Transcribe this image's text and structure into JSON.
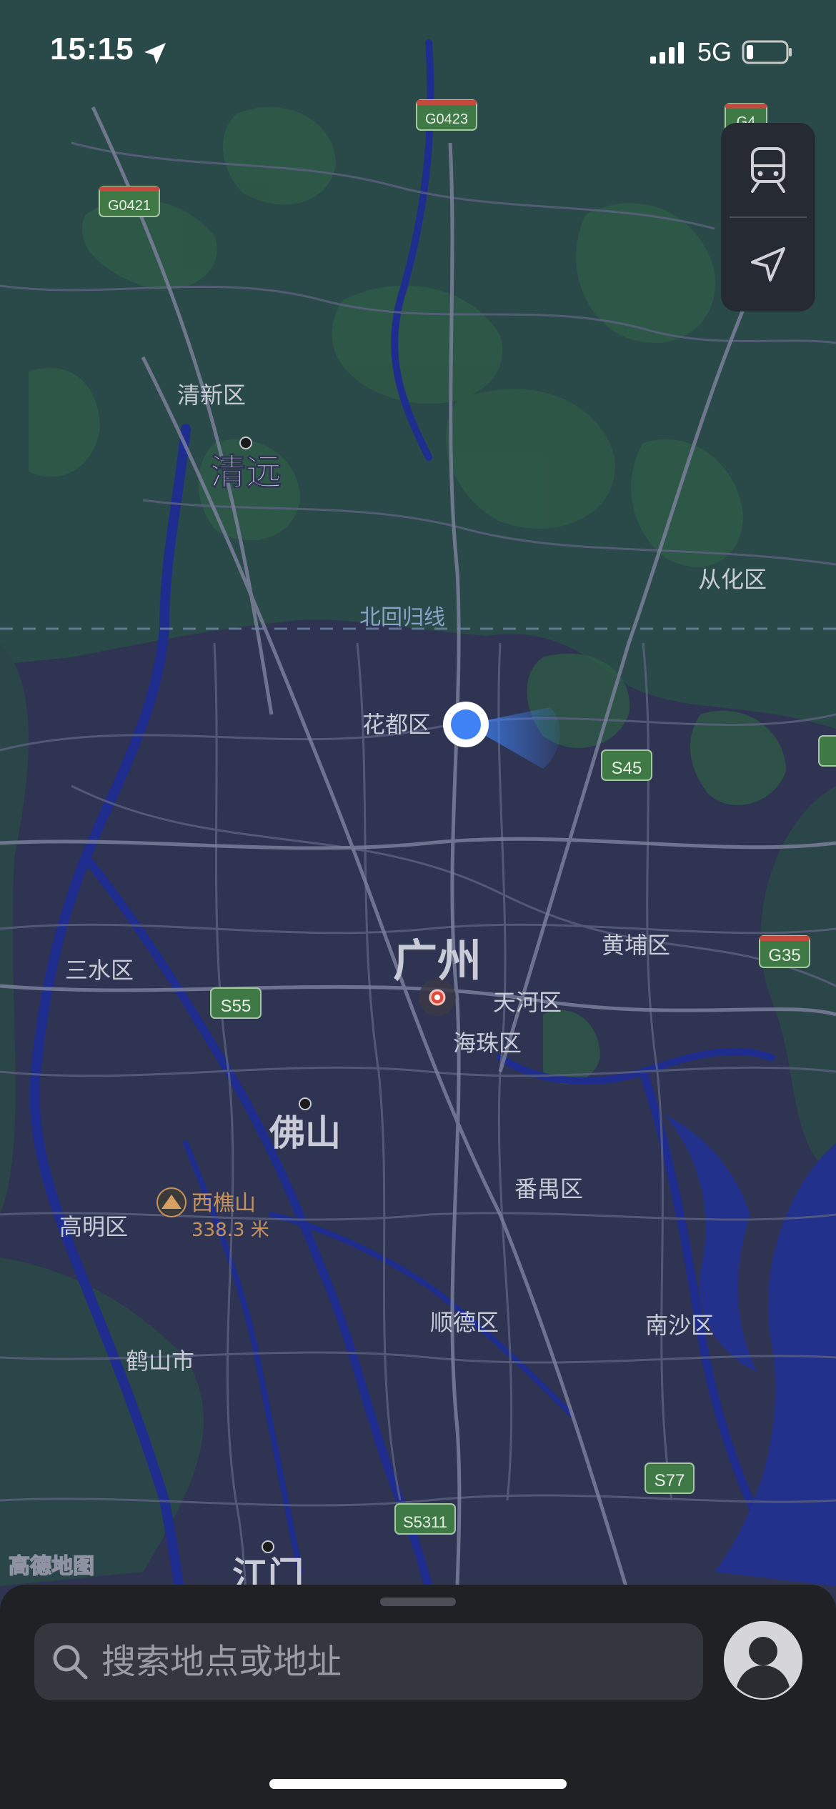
{
  "status_bar": {
    "time": "15:15",
    "network": "5G",
    "battery_level": 0.18,
    "signal_bars": 4,
    "location_active": true
  },
  "map": {
    "provider_logo": "高德地图",
    "tropic_line_label": "北回归线",
    "cities": [
      {
        "name": "清远"
      },
      {
        "name": "广州"
      },
      {
        "name": "佛山"
      },
      {
        "name": "江门"
      }
    ],
    "districts": [
      {
        "name": "清新区"
      },
      {
        "name": "从化区"
      },
      {
        "name": "花都区"
      },
      {
        "name": "三水区"
      },
      {
        "name": "黄埔区"
      },
      {
        "name": "天河区"
      },
      {
        "name": "海珠区"
      },
      {
        "name": "番禺区"
      },
      {
        "name": "高明区"
      },
      {
        "name": "顺德区"
      },
      {
        "name": "南沙区"
      },
      {
        "name": "鹤山市"
      }
    ],
    "road_shields": [
      "G0423",
      "G4",
      "G0421",
      "S45",
      "S55",
      "G35",
      "S77",
      "S5311"
    ],
    "poi": {
      "name": "西樵山",
      "elevation": "338.3 米",
      "icon": "mountain-icon"
    }
  },
  "controls": {
    "transit_icon": "train-icon",
    "locate_icon": "location-arrow-icon"
  },
  "bottom_sheet": {
    "search_placeholder": "搜索地点或地址",
    "avatar_icon": "person-icon"
  },
  "colors": {
    "map_urban": "#2e3452",
    "map_green": "#2a4a46",
    "water": "#23318a",
    "user_dot": "#3f82f5",
    "poi_text": "#c8935a",
    "shield_green": "#3f7a46"
  }
}
